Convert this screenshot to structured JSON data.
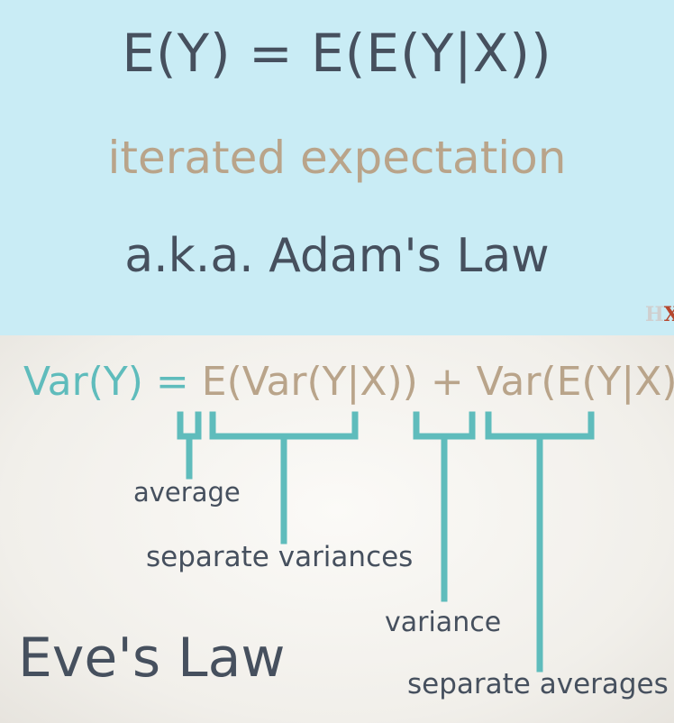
{
  "top": {
    "formula": "E(Y) = E(E(Y|X))",
    "subtitle": "iterated expectation",
    "aka": "a.k.a. Adam's Law"
  },
  "logo": {
    "h": "H",
    "x": "X"
  },
  "bottom": {
    "formula_lhs": "Var(Y) = ",
    "formula_rhs": "E(Var(Y|X)) + Var(E(Y|X))",
    "labels": {
      "average": "average",
      "separate_variances": "separate variances",
      "variance": "variance",
      "separate_averages": "separate averages"
    },
    "title": "Eve's Law"
  },
  "colors": {
    "top_background": "#c9ecf5",
    "slate_text": "#46505e",
    "tan_text": "#b9a48a",
    "teal": "#5fbcbc"
  }
}
